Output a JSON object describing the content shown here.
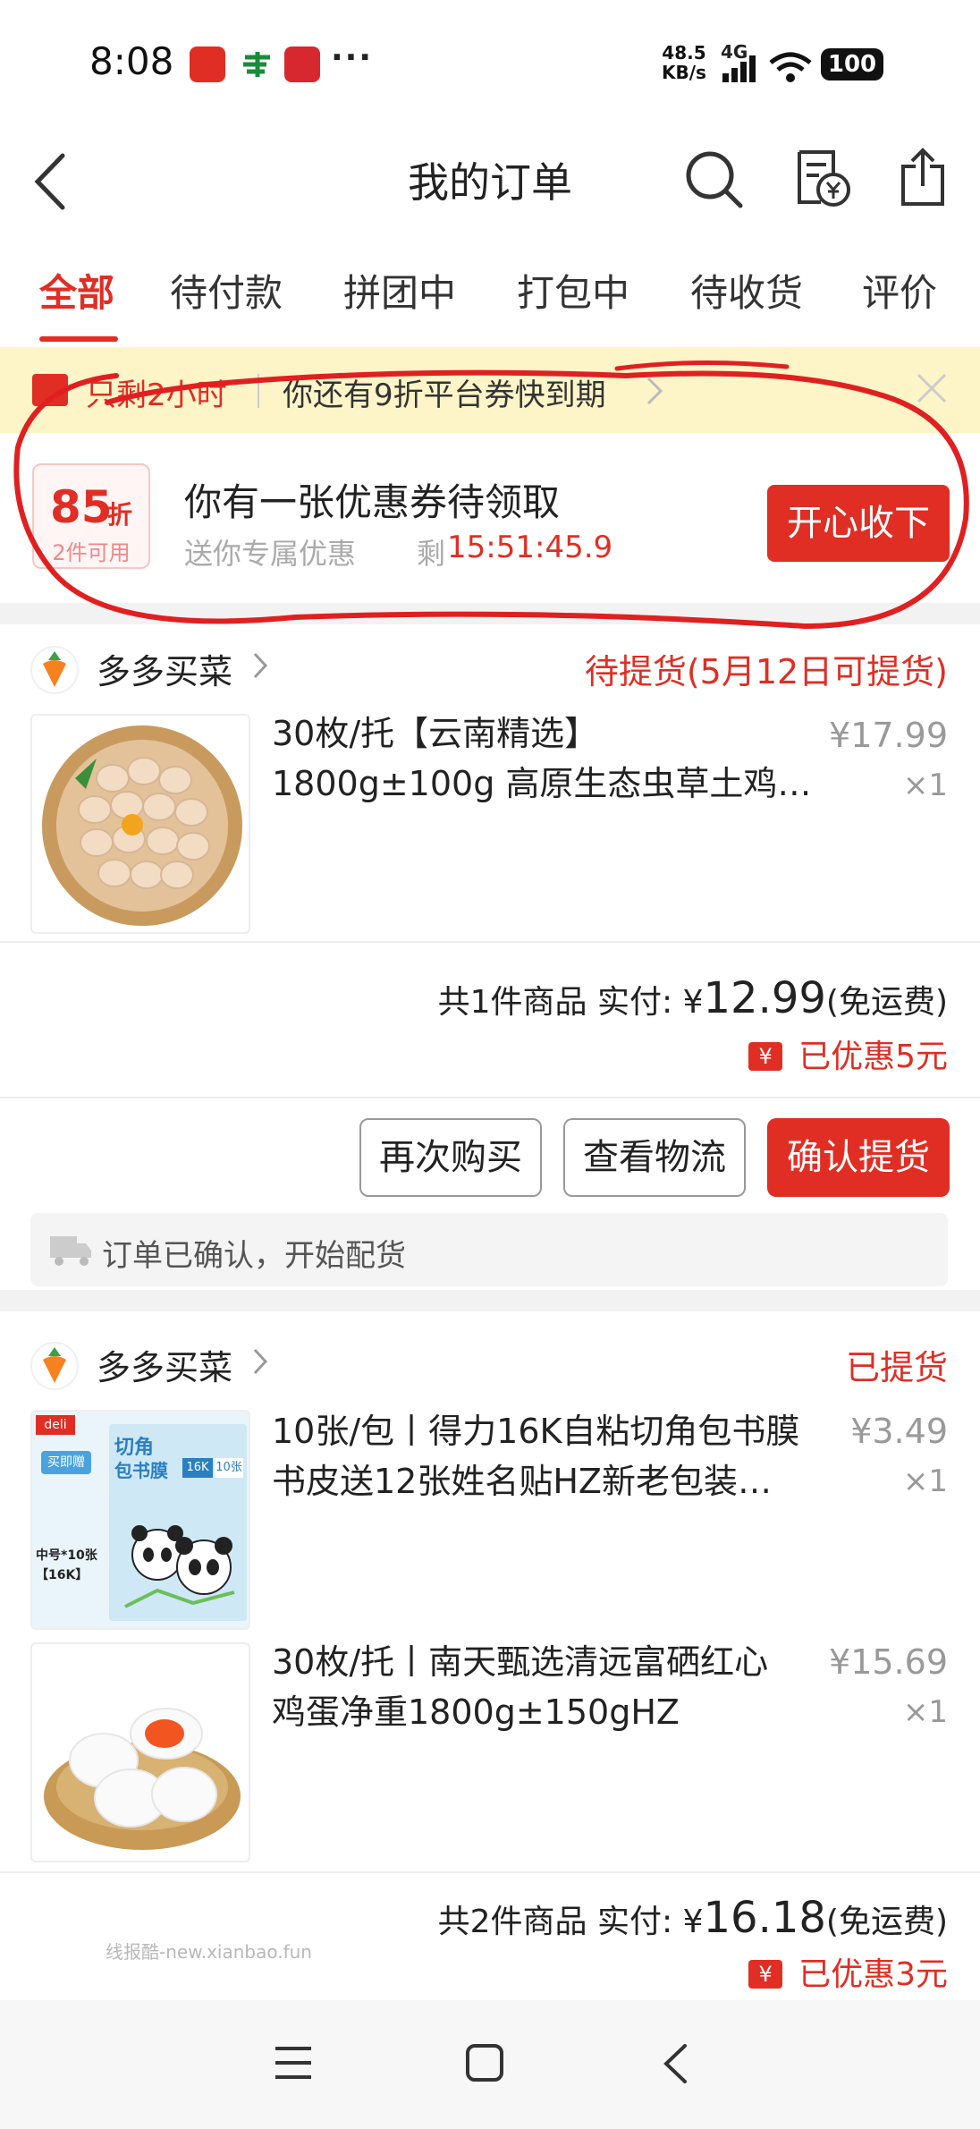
{
  "status_bar": {
    "time": "8:08",
    "net_speed": "48.5",
    "net_unit": "KB/s",
    "net_type": "4G",
    "battery": "100",
    "dots": "···"
  },
  "header": {
    "title": "我的订单"
  },
  "tabs": [
    {
      "label": "全部",
      "active": true
    },
    {
      "label": "待付款"
    },
    {
      "label": "拼团中"
    },
    {
      "label": "打包中"
    },
    {
      "label": "待收货"
    },
    {
      "label": "评价"
    }
  ],
  "banner": {
    "countdown": "只剩2小时",
    "text": "你还有9折平台券快到期"
  },
  "coupon": {
    "discount": "85",
    "discount_unit": "折",
    "usage": "2件可用",
    "title": "你有一张优惠券待领取",
    "subtitle": "送你专属优惠",
    "timer_prefix": "剩",
    "timer": "15:51:45.9",
    "button": "开心收下"
  },
  "orders": [
    {
      "shop": "多多买菜",
      "status": "待提货(5月12日可提货)",
      "items": [
        {
          "title_line1": "30枚/托【云南精选】",
          "title_line2": "1800g±100g 高原生态虫草土鸡…",
          "price": "¥17.99",
          "qty": "×1"
        }
      ],
      "summary_count": "共1件商品",
      "summary_paid_label": "实付:",
      "summary_currency": "¥",
      "summary_amount": "12.99",
      "summary_note": "(免运费)",
      "discount": "已优惠5元",
      "buttons": [
        "再次购买",
        "查看物流",
        "确认提货"
      ],
      "logistics": "订单已确认，开始配货"
    },
    {
      "shop": "多多买菜",
      "status": "已提货",
      "items": [
        {
          "title_line1": "10张/包丨得力16K自粘切角包书膜",
          "title_line2": "书皮送12张姓名贴HZ新老包装…",
          "price": "¥3.49",
          "qty": "×1",
          "thumb_labels": [
            "deli",
            "切角",
            "包书膜",
            "16K",
            "10张",
            "买即赠",
            "中号*10张",
            "【16K】"
          ]
        },
        {
          "title_line1": "30枚/托丨南天甄选清远富硒红心",
          "title_line2": "鸡蛋净重1800g±150gHZ",
          "price": "¥15.69",
          "qty": "×1"
        }
      ],
      "summary_count": "共2件商品",
      "summary_paid_label": "实付:",
      "summary_currency": "¥",
      "summary_amount": "16.18",
      "summary_note": "(免运费)",
      "discount": "已优惠3元"
    }
  ],
  "watermark": "线报酷-new.xianbao.fun",
  "yen_symbol": "¥",
  "colors": {
    "accent": "#e02e24",
    "banner_bg": "#fdf4c8"
  }
}
